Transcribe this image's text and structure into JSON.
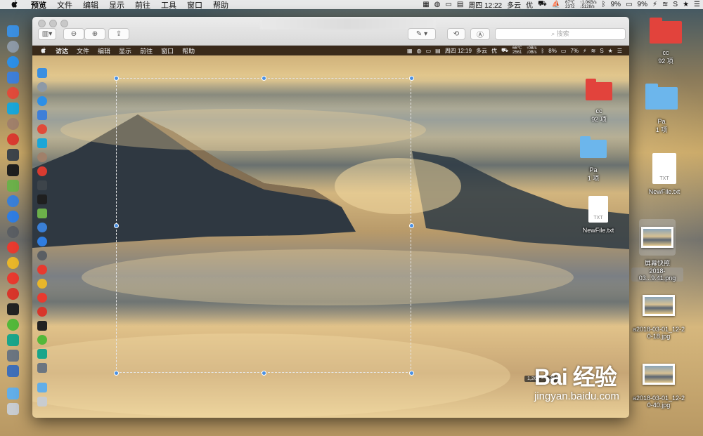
{
  "outer_menubar": {
    "apple": "",
    "app_name": "预览",
    "menus": [
      "文件",
      "编辑",
      "显示",
      "前往",
      "工具",
      "窗口",
      "帮助"
    ],
    "status": {
      "datetime": "周四 12:22",
      "weather": "多云",
      "air": "优",
      "temp": "67℃",
      "rpm": "2372",
      "net_up": "↑1.0KB/s",
      "net_down": "↓5128/s",
      "battery_a": "9%",
      "battery_b": "9%"
    }
  },
  "preview_window": {
    "search_placeholder": "搜索",
    "zoom_out_icon": "zoom-out-icon",
    "zoom_in_icon": "zoom-in-icon"
  },
  "inner_screenshot": {
    "menubar": {
      "app_name": "访达",
      "menus": [
        "文件",
        "编辑",
        "显示",
        "前往",
        "窗口",
        "帮助"
      ],
      "datetime": "周四 12:19",
      "weather": "多云",
      "air": "优",
      "temp": "66℃",
      "rpm": "2561",
      "net_up": "↑0B/s",
      "net_down": "↓0B/s",
      "battery_a": "8%",
      "battery_b": "7%"
    },
    "desktop_items": [
      {
        "name": "cc",
        "sub": "92 项"
      },
      {
        "name": "Pa",
        "sub": "1 项"
      },
      {
        "name": "NewFile.txt",
        "badge": "TXT"
      }
    ],
    "selection_size": "1,264 × 1,264"
  },
  "desktop_items": [
    {
      "name": "cc",
      "sub": "92 项"
    },
    {
      "name": "Pa",
      "sub": "1 项"
    },
    {
      "name": "NewFile.txt",
      "badge": "TXT"
    },
    {
      "name": "屏幕快照",
      "sub": "2018-03...9.41.png"
    },
    {
      "name": "a2018-03-01_12-2",
      "sub": "0-18.jpg"
    },
    {
      "name": "a2018-03-01_12-2",
      "sub": "0-40.jpg"
    }
  ],
  "watermark": {
    "brand": "Bai 经验",
    "url": "jingyan.baidu.com"
  }
}
